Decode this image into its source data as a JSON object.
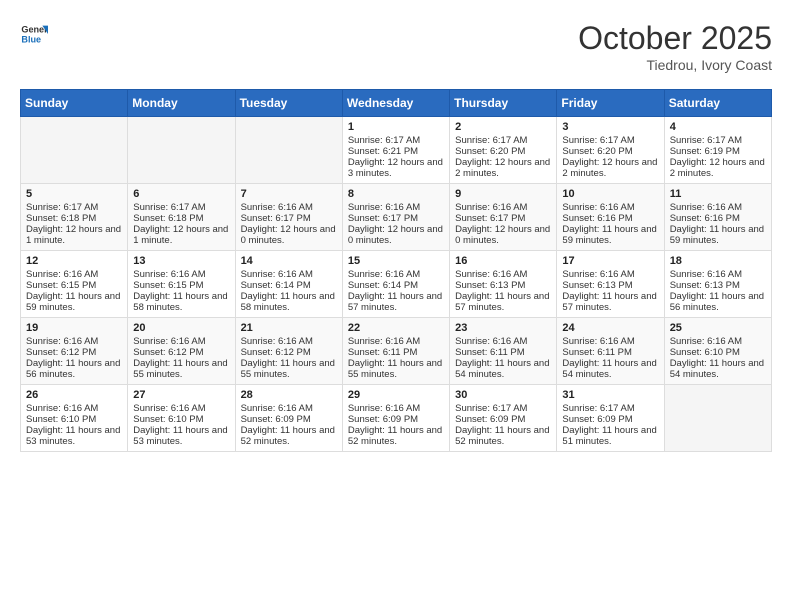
{
  "header": {
    "logo_text_general": "General",
    "logo_text_blue": "Blue",
    "month": "October 2025",
    "location": "Tiedrou, Ivory Coast"
  },
  "weekdays": [
    "Sunday",
    "Monday",
    "Tuesday",
    "Wednesday",
    "Thursday",
    "Friday",
    "Saturday"
  ],
  "weeks": [
    [
      {
        "day": "",
        "sunrise": "",
        "sunset": "",
        "daylight": ""
      },
      {
        "day": "",
        "sunrise": "",
        "sunset": "",
        "daylight": ""
      },
      {
        "day": "",
        "sunrise": "",
        "sunset": "",
        "daylight": ""
      },
      {
        "day": "1",
        "sunrise": "Sunrise: 6:17 AM",
        "sunset": "Sunset: 6:21 PM",
        "daylight": "Daylight: 12 hours and 3 minutes."
      },
      {
        "day": "2",
        "sunrise": "Sunrise: 6:17 AM",
        "sunset": "Sunset: 6:20 PM",
        "daylight": "Daylight: 12 hours and 2 minutes."
      },
      {
        "day": "3",
        "sunrise": "Sunrise: 6:17 AM",
        "sunset": "Sunset: 6:20 PM",
        "daylight": "Daylight: 12 hours and 2 minutes."
      },
      {
        "day": "4",
        "sunrise": "Sunrise: 6:17 AM",
        "sunset": "Sunset: 6:19 PM",
        "daylight": "Daylight: 12 hours and 2 minutes."
      }
    ],
    [
      {
        "day": "5",
        "sunrise": "Sunrise: 6:17 AM",
        "sunset": "Sunset: 6:18 PM",
        "daylight": "Daylight: 12 hours and 1 minute."
      },
      {
        "day": "6",
        "sunrise": "Sunrise: 6:17 AM",
        "sunset": "Sunset: 6:18 PM",
        "daylight": "Daylight: 12 hours and 1 minute."
      },
      {
        "day": "7",
        "sunrise": "Sunrise: 6:16 AM",
        "sunset": "Sunset: 6:17 PM",
        "daylight": "Daylight: 12 hours and 0 minutes."
      },
      {
        "day": "8",
        "sunrise": "Sunrise: 6:16 AM",
        "sunset": "Sunset: 6:17 PM",
        "daylight": "Daylight: 12 hours and 0 minutes."
      },
      {
        "day": "9",
        "sunrise": "Sunrise: 6:16 AM",
        "sunset": "Sunset: 6:17 PM",
        "daylight": "Daylight: 12 hours and 0 minutes."
      },
      {
        "day": "10",
        "sunrise": "Sunrise: 6:16 AM",
        "sunset": "Sunset: 6:16 PM",
        "daylight": "Daylight: 11 hours and 59 minutes."
      },
      {
        "day": "11",
        "sunrise": "Sunrise: 6:16 AM",
        "sunset": "Sunset: 6:16 PM",
        "daylight": "Daylight: 11 hours and 59 minutes."
      }
    ],
    [
      {
        "day": "12",
        "sunrise": "Sunrise: 6:16 AM",
        "sunset": "Sunset: 6:15 PM",
        "daylight": "Daylight: 11 hours and 59 minutes."
      },
      {
        "day": "13",
        "sunrise": "Sunrise: 6:16 AM",
        "sunset": "Sunset: 6:15 PM",
        "daylight": "Daylight: 11 hours and 58 minutes."
      },
      {
        "day": "14",
        "sunrise": "Sunrise: 6:16 AM",
        "sunset": "Sunset: 6:14 PM",
        "daylight": "Daylight: 11 hours and 58 minutes."
      },
      {
        "day": "15",
        "sunrise": "Sunrise: 6:16 AM",
        "sunset": "Sunset: 6:14 PM",
        "daylight": "Daylight: 11 hours and 57 minutes."
      },
      {
        "day": "16",
        "sunrise": "Sunrise: 6:16 AM",
        "sunset": "Sunset: 6:13 PM",
        "daylight": "Daylight: 11 hours and 57 minutes."
      },
      {
        "day": "17",
        "sunrise": "Sunrise: 6:16 AM",
        "sunset": "Sunset: 6:13 PM",
        "daylight": "Daylight: 11 hours and 57 minutes."
      },
      {
        "day": "18",
        "sunrise": "Sunrise: 6:16 AM",
        "sunset": "Sunset: 6:13 PM",
        "daylight": "Daylight: 11 hours and 56 minutes."
      }
    ],
    [
      {
        "day": "19",
        "sunrise": "Sunrise: 6:16 AM",
        "sunset": "Sunset: 6:12 PM",
        "daylight": "Daylight: 11 hours and 56 minutes."
      },
      {
        "day": "20",
        "sunrise": "Sunrise: 6:16 AM",
        "sunset": "Sunset: 6:12 PM",
        "daylight": "Daylight: 11 hours and 55 minutes."
      },
      {
        "day": "21",
        "sunrise": "Sunrise: 6:16 AM",
        "sunset": "Sunset: 6:12 PM",
        "daylight": "Daylight: 11 hours and 55 minutes."
      },
      {
        "day": "22",
        "sunrise": "Sunrise: 6:16 AM",
        "sunset": "Sunset: 6:11 PM",
        "daylight": "Daylight: 11 hours and 55 minutes."
      },
      {
        "day": "23",
        "sunrise": "Sunrise: 6:16 AM",
        "sunset": "Sunset: 6:11 PM",
        "daylight": "Daylight: 11 hours and 54 minutes."
      },
      {
        "day": "24",
        "sunrise": "Sunrise: 6:16 AM",
        "sunset": "Sunset: 6:11 PM",
        "daylight": "Daylight: 11 hours and 54 minutes."
      },
      {
        "day": "25",
        "sunrise": "Sunrise: 6:16 AM",
        "sunset": "Sunset: 6:10 PM",
        "daylight": "Daylight: 11 hours and 54 minutes."
      }
    ],
    [
      {
        "day": "26",
        "sunrise": "Sunrise: 6:16 AM",
        "sunset": "Sunset: 6:10 PM",
        "daylight": "Daylight: 11 hours and 53 minutes."
      },
      {
        "day": "27",
        "sunrise": "Sunrise: 6:16 AM",
        "sunset": "Sunset: 6:10 PM",
        "daylight": "Daylight: 11 hours and 53 minutes."
      },
      {
        "day": "28",
        "sunrise": "Sunrise: 6:16 AM",
        "sunset": "Sunset: 6:09 PM",
        "daylight": "Daylight: 11 hours and 52 minutes."
      },
      {
        "day": "29",
        "sunrise": "Sunrise: 6:16 AM",
        "sunset": "Sunset: 6:09 PM",
        "daylight": "Daylight: 11 hours and 52 minutes."
      },
      {
        "day": "30",
        "sunrise": "Sunrise: 6:17 AM",
        "sunset": "Sunset: 6:09 PM",
        "daylight": "Daylight: 11 hours and 52 minutes."
      },
      {
        "day": "31",
        "sunrise": "Sunrise: 6:17 AM",
        "sunset": "Sunset: 6:09 PM",
        "daylight": "Daylight: 11 hours and 51 minutes."
      },
      {
        "day": "",
        "sunrise": "",
        "sunset": "",
        "daylight": ""
      }
    ]
  ]
}
